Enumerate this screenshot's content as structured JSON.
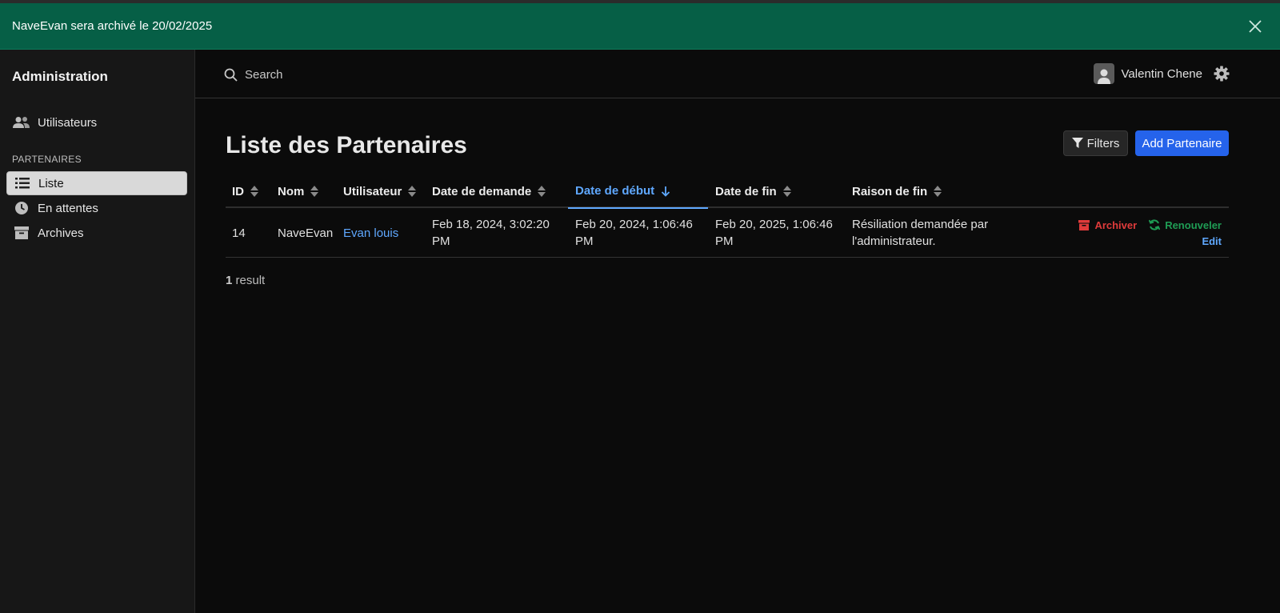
{
  "banner": {
    "message": "NaveEvan sera archivé le 20/02/2025"
  },
  "sidebar": {
    "title": "Administration",
    "users_label": "Utilisateurs",
    "section_label": "PARTENAIRES",
    "items": [
      {
        "label": "Liste",
        "icon": "list-icon",
        "active": true
      },
      {
        "label": "En attentes",
        "icon": "clock-icon",
        "active": false
      },
      {
        "label": "Archives",
        "icon": "archive-box-icon",
        "active": false
      }
    ]
  },
  "header": {
    "search_placeholder": "Search",
    "user_name": "Valentin Chene"
  },
  "main": {
    "title": "Liste des Partenaires",
    "filters_label": "Filters",
    "add_label": "Add Partenaire",
    "result_count": "1",
    "result_label": " result"
  },
  "table": {
    "columns": [
      {
        "label": "ID",
        "sorted": false
      },
      {
        "label": "Nom",
        "sorted": false
      },
      {
        "label": "Utilisateur",
        "sorted": false
      },
      {
        "label": "Date de demande",
        "sorted": false
      },
      {
        "label": "Date de début",
        "sorted": true,
        "direction": "desc"
      },
      {
        "label": "Date de fin",
        "sorted": false
      },
      {
        "label": "Raison de fin",
        "sorted": false
      }
    ],
    "rows": [
      {
        "id": "14",
        "nom": "NaveEvan",
        "utilisateur": "Evan louis",
        "date_demande": "Feb 18, 2024, 3:02:20 PM",
        "date_debut": "Feb 20, 2024, 1:06:46 PM",
        "date_fin": "Feb 20, 2025, 1:06:46 PM",
        "raison_fin": "Résiliation demandée par l'administrateur.",
        "actions": {
          "archive": "Archiver",
          "renew": "Renouveler",
          "edit": "Edit"
        }
      }
    ]
  },
  "colors": {
    "banner_bg": "#065f46",
    "primary": "#2563eb",
    "link": "#5fa8ff",
    "danger": "#e03b3b",
    "success": "#1f9d55"
  }
}
